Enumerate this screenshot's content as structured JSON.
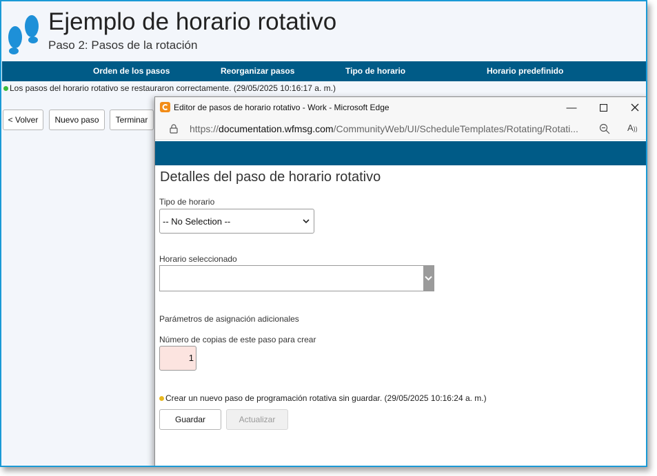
{
  "page": {
    "title": "Ejemplo de horario rotativo",
    "subtitle": "Paso 2: Pasos de la rotación"
  },
  "nav": {
    "items": [
      "Orden de los pasos",
      "Reorganizar pasos",
      "Tipo de horario",
      "Horario predefinido"
    ]
  },
  "status": {
    "message": "Los pasos del horario rotativo se restauraron correctamente. (29/05/2025 10:16:17 a. m.)",
    "color": "#3cba3c"
  },
  "toolbar": {
    "back_label": "< Volver",
    "new_step_label": "Nuevo paso",
    "finish_label": "Terminar"
  },
  "popup": {
    "window_title": "Editor de pasos de horario rotativo - Work - Microsoft Edge",
    "url_prefix": "https://",
    "url_domain": "documentation.wfmsg.com",
    "url_path": "/CommunityWeb/UI/ScheduleTemplates/Rotating/Rotati...",
    "heading": "Detalles del paso de horario rotativo",
    "schedule_type_label": "Tipo de horario",
    "schedule_type_value": "-- No Selection --",
    "selected_schedule_label": "Horario seleccionado",
    "selected_schedule_value": "",
    "extra_params_label": "Parámetros de asignación adicionales",
    "copies_label": "Número de copias de este paso para crear",
    "copies_value": "1",
    "status_message": "Crear un nuevo paso de programación rotativa sin guardar. (29/05/2025 10:16:24 a. m.)",
    "save_label": "Guardar",
    "update_label": "Actualizar"
  },
  "colors": {
    "accent": "#005b87",
    "frame": "#1a9ad6",
    "edge_icon": "#f28c18"
  }
}
